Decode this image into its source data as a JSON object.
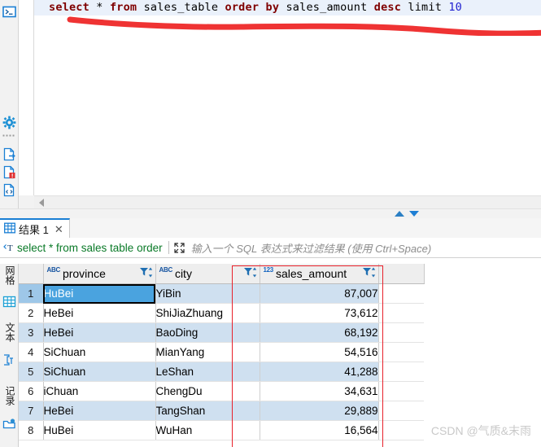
{
  "editor": {
    "sql_tokens": [
      {
        "t": "select",
        "c": "kw"
      },
      {
        "t": " ",
        "c": "plain"
      },
      {
        "t": "*",
        "c": "star"
      },
      {
        "t": " ",
        "c": "plain"
      },
      {
        "t": "from",
        "c": "kw"
      },
      {
        "t": " sales_table ",
        "c": "plain"
      },
      {
        "t": "order",
        "c": "kw"
      },
      {
        "t": " ",
        "c": "plain"
      },
      {
        "t": "by",
        "c": "kw"
      },
      {
        "t": " sales_amount ",
        "c": "plain"
      },
      {
        "t": "desc",
        "c": "kw"
      },
      {
        "t": " limit ",
        "c": "plain"
      },
      {
        "t": "10",
        "c": "num"
      }
    ],
    "sql_text": "select * from sales_table order by sales_amount desc limit 10",
    "annotation_color": "#e8202a"
  },
  "left_rail": {
    "icons": [
      {
        "name": "console-icon",
        "label": "SQL 控制台"
      },
      {
        "name": "gear-icon",
        "label": "设置"
      },
      {
        "name": "export-file-icon",
        "label": "导出"
      },
      {
        "name": "error-file-icon",
        "label": "错误"
      },
      {
        "name": "script-file-icon",
        "label": "脚本"
      }
    ]
  },
  "tabbar": {
    "tab": {
      "icon": "grid-icon",
      "label": "结果 1",
      "close": "✕"
    }
  },
  "filterbar": {
    "icon": "filter-text-icon",
    "prefix": "select * from sales  table order",
    "expand_icon": "expand-icon",
    "placeholder": "输入一个 SQL 表达式来过滤结果 (使用 Ctrl+Space)"
  },
  "grid_rail": {
    "items": [
      {
        "name": "grid-view-icon",
        "label": "网格"
      },
      {
        "name": "text-view-icon",
        "label": "文本"
      },
      {
        "name": "record-view-icon",
        "label": "记录"
      }
    ]
  },
  "grid": {
    "row_header": "",
    "columns": [
      {
        "name": "province",
        "type_badge": "ABC",
        "type": "text"
      },
      {
        "name": "city",
        "type_badge": "ABC",
        "type": "text"
      },
      {
        "name": "sales_amount",
        "type_badge": "123",
        "type": "number"
      }
    ],
    "rows": [
      {
        "n": "1",
        "province": "HuBei",
        "city": "YiBin",
        "sales_amount": "87,007"
      },
      {
        "n": "2",
        "province": "HeBei",
        "city": "ShiJiaZhuang",
        "sales_amount": "73,612"
      },
      {
        "n": "3",
        "province": "HeBei",
        "city": "BaoDing",
        "sales_amount": "68,192"
      },
      {
        "n": "4",
        "province": "SiChuan",
        "city": "MianYang",
        "sales_amount": "54,516"
      },
      {
        "n": "5",
        "province": "SiChuan",
        "city": "LeShan",
        "sales_amount": "41,288"
      },
      {
        "n": "6",
        "province": "iChuan",
        "city": "ChengDu",
        "sales_amount": "34,631"
      },
      {
        "n": "7",
        "province": "HeBei",
        "city": "TangShan",
        "sales_amount": "29,889"
      },
      {
        "n": "8",
        "province": "HuBei",
        "city": "WuHan",
        "sales_amount": "16,564"
      }
    ],
    "selected_cell": {
      "row": 1,
      "column": "province"
    }
  },
  "watermark": {
    "text": "CSDN @气质&末雨"
  },
  "colors": {
    "header_blue": "#4aa3df",
    "row_alt_blue": "#cfe0f0",
    "keyword_red": "#7f0000",
    "number_blue": "#2020d0",
    "filter_green": "#0a7a28",
    "annotation_red": "#e8202a",
    "tab_accent": "#1a7fd4"
  }
}
